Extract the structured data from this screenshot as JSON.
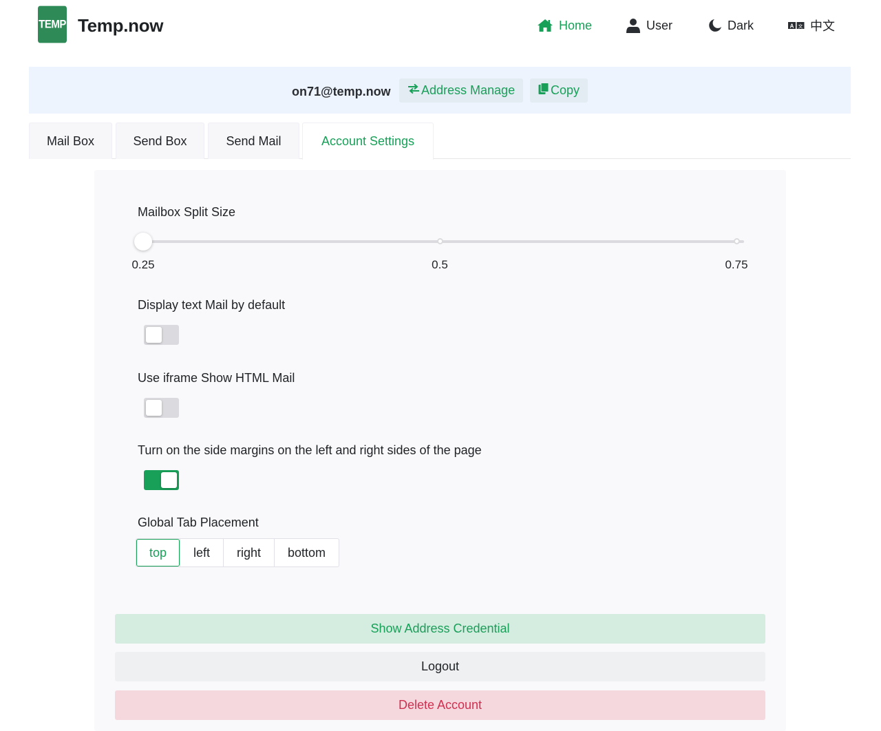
{
  "header": {
    "logo_text": "TEMP",
    "brand": "Temp.now",
    "nav": [
      {
        "label": "Home",
        "icon": "home-icon",
        "active": true
      },
      {
        "label": "User",
        "icon": "user-icon",
        "active": false
      },
      {
        "label": "Dark",
        "icon": "moon-icon",
        "active": false
      },
      {
        "label": "中文",
        "icon": "language-icon",
        "active": false
      }
    ]
  },
  "address_bar": {
    "address": "on71@temp.now",
    "manage_label": "Address Manage",
    "copy_label": "Copy"
  },
  "tabs": [
    {
      "label": "Mail Box",
      "active": false
    },
    {
      "label": "Send Box",
      "active": false
    },
    {
      "label": "Send Mail",
      "active": false
    },
    {
      "label": "Account Settings",
      "active": true
    }
  ],
  "settings": {
    "split_size": {
      "label": "Mailbox Split Size",
      "value": 0.25,
      "min": 0.25,
      "max": 0.75,
      "marks": [
        "0.25",
        "0.5",
        "0.75"
      ]
    },
    "display_text_mail": {
      "label": "Display text Mail by default",
      "enabled": false
    },
    "use_iframe": {
      "label": "Use iframe Show HTML Mail",
      "enabled": false
    },
    "side_margins": {
      "label": "Turn on the side margins on the left and right sides of the page",
      "enabled": true
    },
    "tab_placement": {
      "label": "Global Tab Placement",
      "options": [
        "top",
        "left",
        "right",
        "bottom"
      ],
      "selected": "top"
    }
  },
  "actions": {
    "show_credential": "Show Address Credential",
    "logout": "Logout",
    "delete_account": "Delete Account"
  },
  "colors": {
    "primary": "#18a058",
    "danger": "#d03050",
    "logo": "#2e8b57"
  }
}
